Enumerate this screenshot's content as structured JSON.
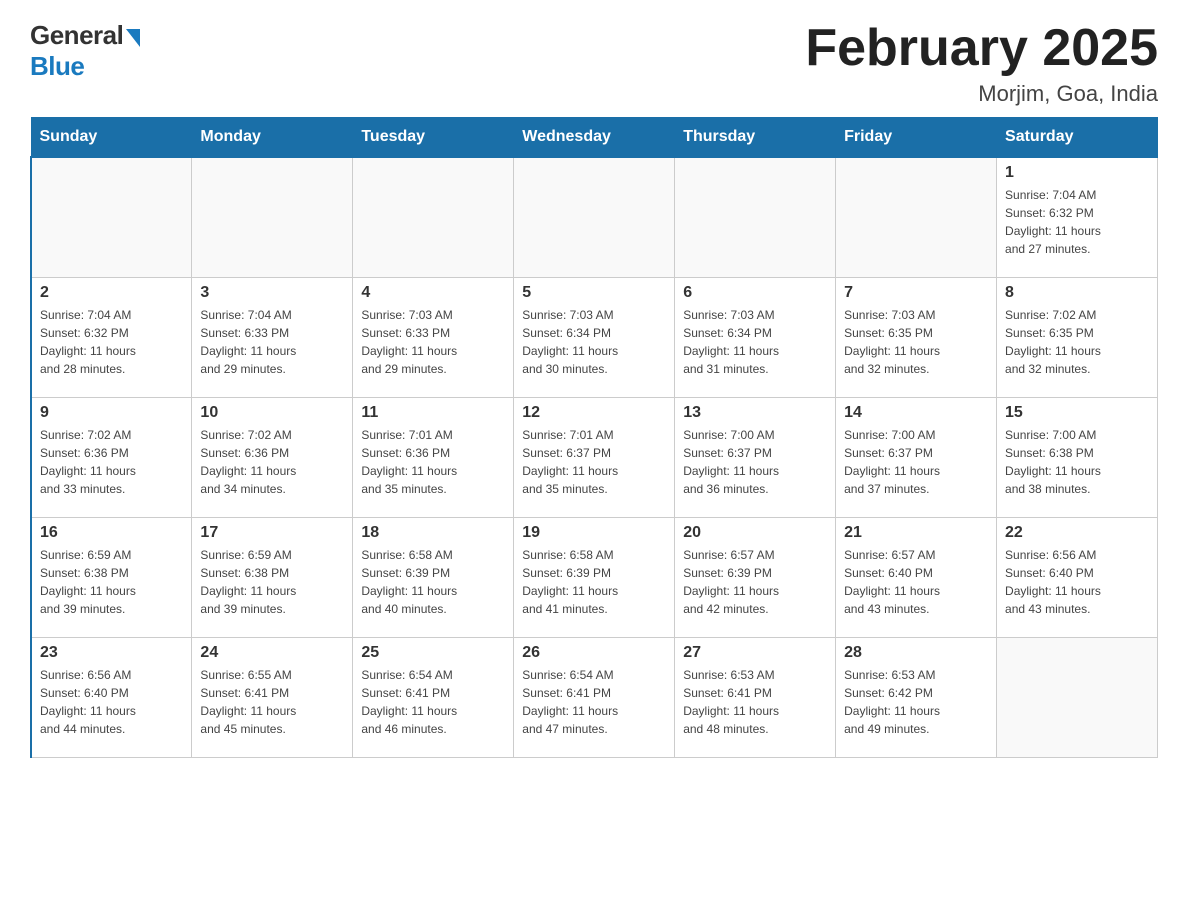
{
  "header": {
    "logo_general": "General",
    "logo_blue": "Blue",
    "title": "February 2025",
    "subtitle": "Morjim, Goa, India"
  },
  "days_of_week": [
    "Sunday",
    "Monday",
    "Tuesday",
    "Wednesday",
    "Thursday",
    "Friday",
    "Saturday"
  ],
  "weeks": [
    [
      {
        "day": "",
        "info": ""
      },
      {
        "day": "",
        "info": ""
      },
      {
        "day": "",
        "info": ""
      },
      {
        "day": "",
        "info": ""
      },
      {
        "day": "",
        "info": ""
      },
      {
        "day": "",
        "info": ""
      },
      {
        "day": "1",
        "info": "Sunrise: 7:04 AM\nSunset: 6:32 PM\nDaylight: 11 hours\nand 27 minutes."
      }
    ],
    [
      {
        "day": "2",
        "info": "Sunrise: 7:04 AM\nSunset: 6:32 PM\nDaylight: 11 hours\nand 28 minutes."
      },
      {
        "day": "3",
        "info": "Sunrise: 7:04 AM\nSunset: 6:33 PM\nDaylight: 11 hours\nand 29 minutes."
      },
      {
        "day": "4",
        "info": "Sunrise: 7:03 AM\nSunset: 6:33 PM\nDaylight: 11 hours\nand 29 minutes."
      },
      {
        "day": "5",
        "info": "Sunrise: 7:03 AM\nSunset: 6:34 PM\nDaylight: 11 hours\nand 30 minutes."
      },
      {
        "day": "6",
        "info": "Sunrise: 7:03 AM\nSunset: 6:34 PM\nDaylight: 11 hours\nand 31 minutes."
      },
      {
        "day": "7",
        "info": "Sunrise: 7:03 AM\nSunset: 6:35 PM\nDaylight: 11 hours\nand 32 minutes."
      },
      {
        "day": "8",
        "info": "Sunrise: 7:02 AM\nSunset: 6:35 PM\nDaylight: 11 hours\nand 32 minutes."
      }
    ],
    [
      {
        "day": "9",
        "info": "Sunrise: 7:02 AM\nSunset: 6:36 PM\nDaylight: 11 hours\nand 33 minutes."
      },
      {
        "day": "10",
        "info": "Sunrise: 7:02 AM\nSunset: 6:36 PM\nDaylight: 11 hours\nand 34 minutes."
      },
      {
        "day": "11",
        "info": "Sunrise: 7:01 AM\nSunset: 6:36 PM\nDaylight: 11 hours\nand 35 minutes."
      },
      {
        "day": "12",
        "info": "Sunrise: 7:01 AM\nSunset: 6:37 PM\nDaylight: 11 hours\nand 35 minutes."
      },
      {
        "day": "13",
        "info": "Sunrise: 7:00 AM\nSunset: 6:37 PM\nDaylight: 11 hours\nand 36 minutes."
      },
      {
        "day": "14",
        "info": "Sunrise: 7:00 AM\nSunset: 6:37 PM\nDaylight: 11 hours\nand 37 minutes."
      },
      {
        "day": "15",
        "info": "Sunrise: 7:00 AM\nSunset: 6:38 PM\nDaylight: 11 hours\nand 38 minutes."
      }
    ],
    [
      {
        "day": "16",
        "info": "Sunrise: 6:59 AM\nSunset: 6:38 PM\nDaylight: 11 hours\nand 39 minutes."
      },
      {
        "day": "17",
        "info": "Sunrise: 6:59 AM\nSunset: 6:38 PM\nDaylight: 11 hours\nand 39 minutes."
      },
      {
        "day": "18",
        "info": "Sunrise: 6:58 AM\nSunset: 6:39 PM\nDaylight: 11 hours\nand 40 minutes."
      },
      {
        "day": "19",
        "info": "Sunrise: 6:58 AM\nSunset: 6:39 PM\nDaylight: 11 hours\nand 41 minutes."
      },
      {
        "day": "20",
        "info": "Sunrise: 6:57 AM\nSunset: 6:39 PM\nDaylight: 11 hours\nand 42 minutes."
      },
      {
        "day": "21",
        "info": "Sunrise: 6:57 AM\nSunset: 6:40 PM\nDaylight: 11 hours\nand 43 minutes."
      },
      {
        "day": "22",
        "info": "Sunrise: 6:56 AM\nSunset: 6:40 PM\nDaylight: 11 hours\nand 43 minutes."
      }
    ],
    [
      {
        "day": "23",
        "info": "Sunrise: 6:56 AM\nSunset: 6:40 PM\nDaylight: 11 hours\nand 44 minutes."
      },
      {
        "day": "24",
        "info": "Sunrise: 6:55 AM\nSunset: 6:41 PM\nDaylight: 11 hours\nand 45 minutes."
      },
      {
        "day": "25",
        "info": "Sunrise: 6:54 AM\nSunset: 6:41 PM\nDaylight: 11 hours\nand 46 minutes."
      },
      {
        "day": "26",
        "info": "Sunrise: 6:54 AM\nSunset: 6:41 PM\nDaylight: 11 hours\nand 47 minutes."
      },
      {
        "day": "27",
        "info": "Sunrise: 6:53 AM\nSunset: 6:41 PM\nDaylight: 11 hours\nand 48 minutes."
      },
      {
        "day": "28",
        "info": "Sunrise: 6:53 AM\nSunset: 6:42 PM\nDaylight: 11 hours\nand 49 minutes."
      },
      {
        "day": "",
        "info": ""
      }
    ]
  ]
}
